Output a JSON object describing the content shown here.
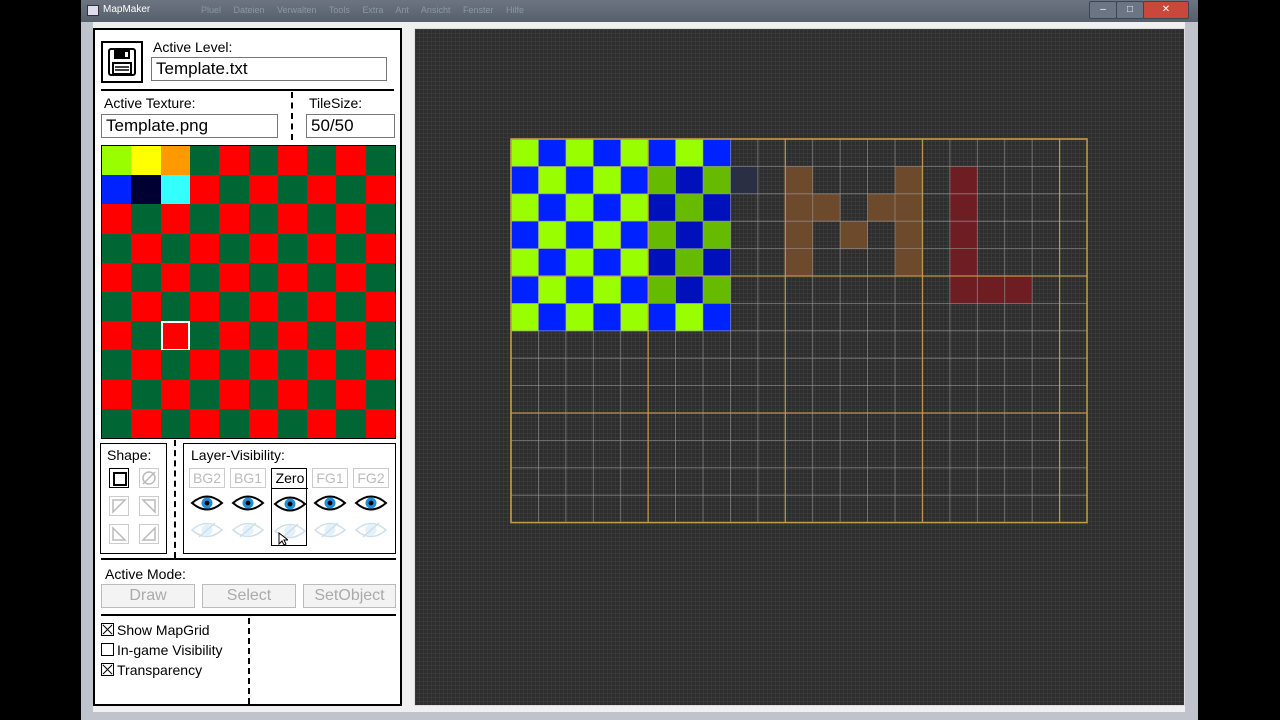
{
  "window": {
    "title": "MapMaker",
    "menu_ghost": "Pluel Dateien Verwalten Tools Extra Ant Ansicht Fenster Hilfe",
    "min": "–",
    "max": "□",
    "close": "✕"
  },
  "level": {
    "label": "Active Level:",
    "value": "Template.txt",
    "icon": "save-disk-icon"
  },
  "texture": {
    "label": "Active Texture:",
    "value": "Template.png"
  },
  "tilesize": {
    "label": "TileSize:",
    "value": "50/50"
  },
  "palette": {
    "cols": 10,
    "rows": 10,
    "colors": {
      "red": "#ff0000",
      "green": "#006633",
      "lime": "#99ff00",
      "yellow": "#ffff00",
      "orange": "#ff9900",
      "blue": "#0022ff",
      "navy": "#000033",
      "cyan": "#33ffff"
    },
    "special": [
      [
        "lime",
        "yellow",
        "orange"
      ],
      [
        "blue",
        "navy",
        "cyan"
      ]
    ],
    "selected": {
      "row": 6,
      "col": 2
    }
  },
  "shape": {
    "label": "Shape:"
  },
  "layers": {
    "label": "Layer-Visibility:",
    "items": [
      {
        "name": "BG2",
        "active": false
      },
      {
        "name": "BG1",
        "active": false
      },
      {
        "name": "Zero",
        "active": true
      },
      {
        "name": "FG1",
        "active": false
      },
      {
        "name": "FG2",
        "active": false
      }
    ]
  },
  "mode": {
    "label": "Active Mode:",
    "buttons": [
      "Draw",
      "Select",
      "SetObject"
    ]
  },
  "options": [
    {
      "label": "Show MapGrid",
      "checked": true
    },
    {
      "label": "In-game Visibility",
      "checked": false
    },
    {
      "label": "Transparency",
      "checked": true
    }
  ],
  "map": {
    "cols": 21,
    "rows": 14,
    "colors": {
      "lime": "#99ff00",
      "blue": "#0022ff",
      "lime_dim": "#66bb00",
      "blue_dim": "#0011bb",
      "brown": "#6e4a2c",
      "darkred": "#6e1e22",
      "ghost": "#2a2f44",
      "grid": "#9a9a9a",
      "major": "#c39a4c"
    },
    "checker": {
      "cols": 8,
      "rows": 7
    }
  }
}
